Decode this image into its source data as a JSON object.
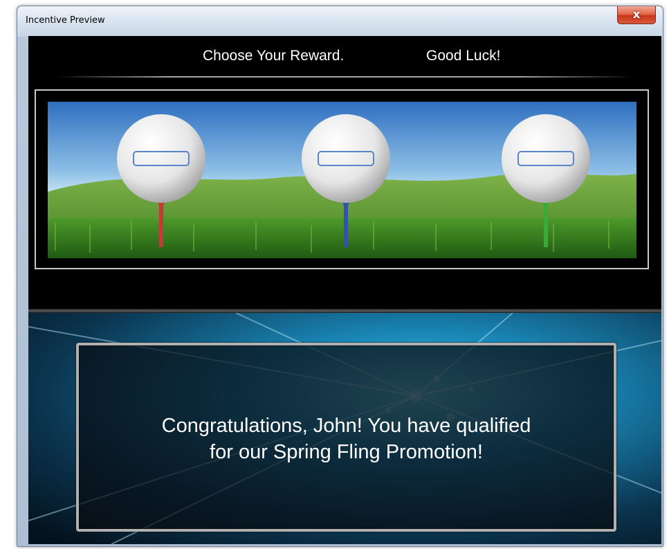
{
  "window": {
    "title": "Incentive Preview",
    "close_glyph": "x"
  },
  "header": {
    "left_text": "Choose Your Reward.",
    "right_text": "Good Luck!"
  },
  "rewards": {
    "options": [
      {
        "tee_color": "#c43a3a"
      },
      {
        "tee_color": "#3450b0"
      },
      {
        "tee_color": "#3aaa3a"
      }
    ]
  },
  "promotion": {
    "line1": "Congratulations, John! You have qualified",
    "line2": "for our Spring Fling Promotion!"
  },
  "colors": {
    "sky_top": "#2f6fc0",
    "grass": "#3f8a25",
    "promo_blue": "#1a88b8"
  }
}
